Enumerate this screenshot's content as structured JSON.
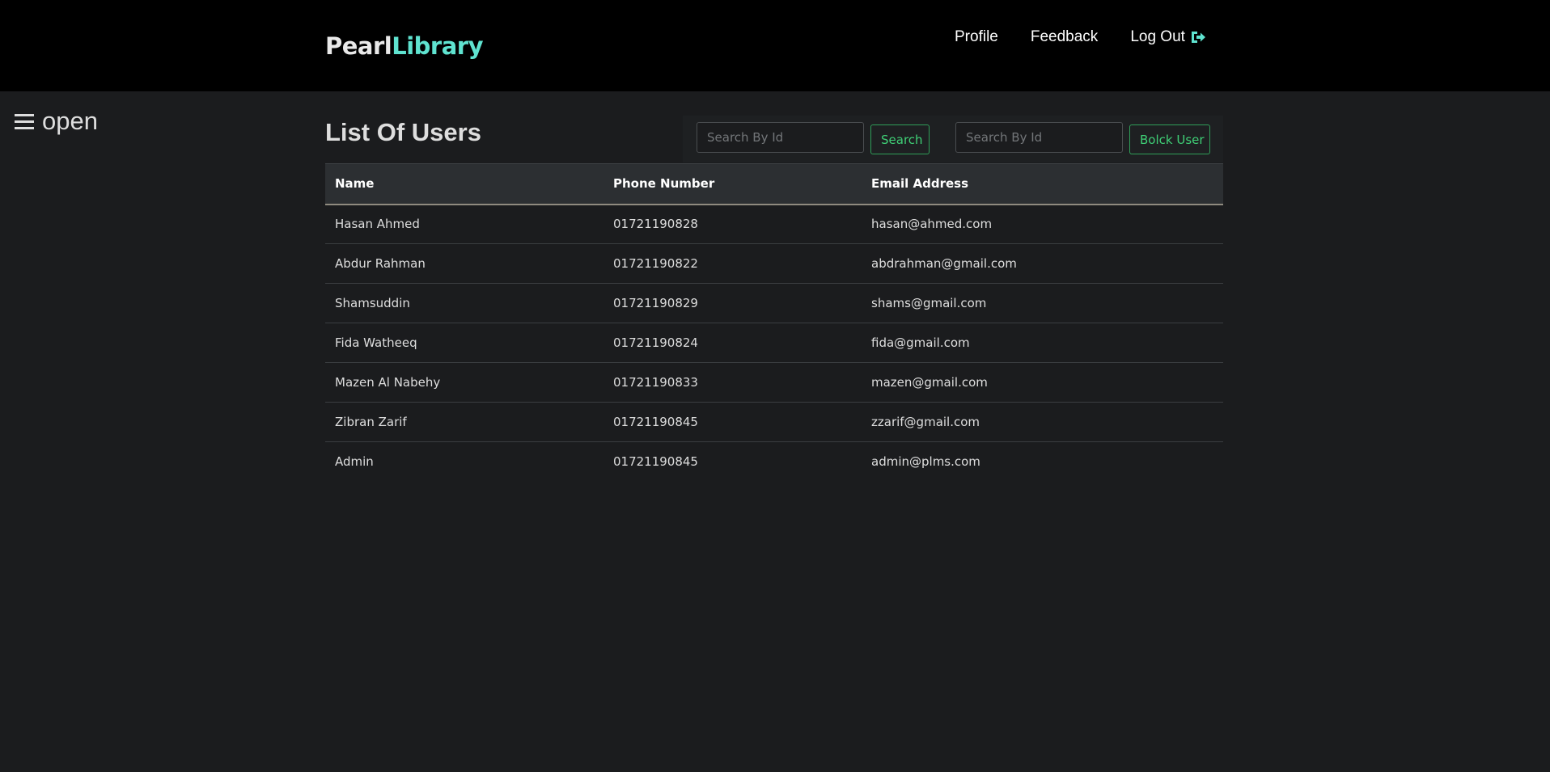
{
  "navbar": {
    "brand_part1": "Pearl",
    "brand_part2": "Library",
    "links": {
      "profile": "Profile",
      "feedback": "Feedback",
      "logout": "Log Out"
    },
    "logout_icon": "sign-out-icon",
    "accent_color": "#5fe3d0"
  },
  "sidebar": {
    "toggle_label": "open",
    "toggle_icon": "hamburger-icon"
  },
  "main": {
    "title": "List Of Users",
    "search": {
      "placeholder": "Search By Id",
      "button_label": "Search"
    },
    "block": {
      "placeholder": "Search By Id",
      "button_label": "Bolck User"
    },
    "button_color": "#3fcf76",
    "table": {
      "headers": {
        "name": "Name",
        "phone": "Phone Number",
        "email": "Email Address"
      },
      "rows": [
        {
          "name": "Hasan Ahmed",
          "phone": "01721190828",
          "email": "hasan@ahmed.com"
        },
        {
          "name": "Abdur Rahman",
          "phone": "01721190822",
          "email": "abdrahman@gmail.com"
        },
        {
          "name": "Shamsuddin",
          "phone": "01721190829",
          "email": "shams@gmail.com"
        },
        {
          "name": "Fida Watheeq",
          "phone": "01721190824",
          "email": "fida@gmail.com"
        },
        {
          "name": "Mazen Al Nabehy",
          "phone": "01721190833",
          "email": "mazen@gmail.com"
        },
        {
          "name": "Zibran Zarif",
          "phone": "01721190845",
          "email": "zzarif@gmail.com"
        },
        {
          "name": "Admin",
          "phone": "01721190845",
          "email": "admin@plms.com"
        }
      ]
    }
  }
}
